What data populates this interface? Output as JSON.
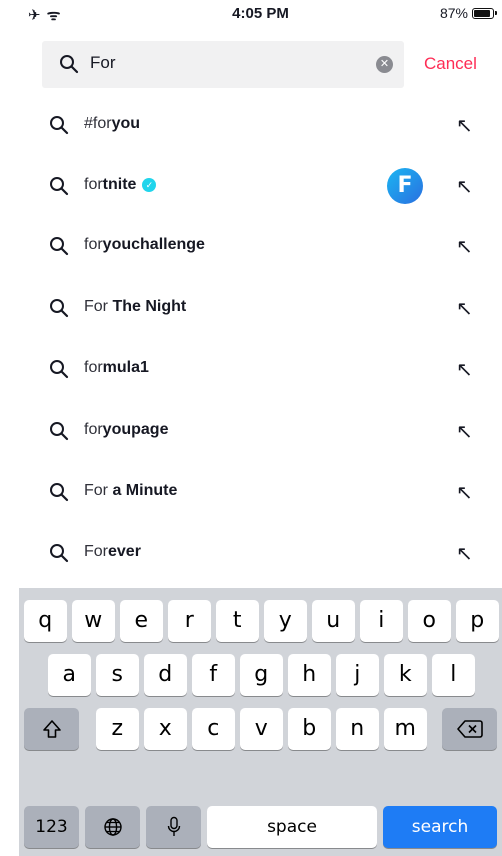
{
  "status_bar": {
    "left_icons": "✈ ᯤ",
    "time": "4:05 PM",
    "battery_text": "87%"
  },
  "search": {
    "value": "For",
    "cancel_label": "Cancel"
  },
  "suggestions": [
    {
      "typed": "#for",
      "rest": "you"
    },
    {
      "typed": "for",
      "rest": "tnite",
      "verified": true,
      "avatar_letter": "F"
    },
    {
      "typed": "for",
      "rest": "youchallenge"
    },
    {
      "typed": "For ",
      "rest": "The Night"
    },
    {
      "typed": "for",
      "rest": "mula1"
    },
    {
      "typed": "for",
      "rest": "youpage"
    },
    {
      "typed": "For ",
      "rest": "a Minute"
    },
    {
      "typed": "For",
      "rest": "ever"
    }
  ],
  "keyboard": {
    "row1": [
      "q",
      "w",
      "e",
      "r",
      "t",
      "y",
      "u",
      "i",
      "o",
      "p"
    ],
    "row2": [
      "a",
      "s",
      "d",
      "f",
      "g",
      "h",
      "j",
      "k",
      "l"
    ],
    "row3": [
      "z",
      "x",
      "c",
      "v",
      "b",
      "n",
      "m"
    ],
    "numbers_label": "123",
    "space_label": "space",
    "search_label": "search"
  },
  "colors": {
    "accent": "#fe2c55",
    "search_key": "#1e7cf5",
    "verified": "#20d5ec"
  }
}
